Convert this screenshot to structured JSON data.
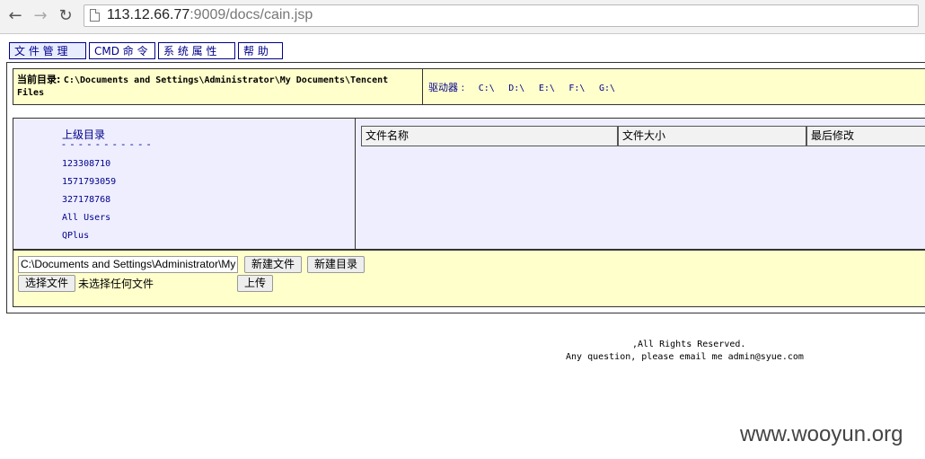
{
  "browser": {
    "url_host": "113.12.66.77",
    "url_rest": ":9009/docs/cain.jsp"
  },
  "menu": {
    "file_manage": "文 件 管 理",
    "cmd": "CMD 命 令",
    "sys_props": "系 统 属 性",
    "help": "帮 助"
  },
  "current_dir": {
    "label": "当前目录:",
    "path": "C:\\Documents and Settings\\Administrator\\My Documents\\Tencent Files"
  },
  "drives": {
    "label": "驱动器 :",
    "items": [
      "C:\\",
      "D:\\",
      "E:\\",
      "F:\\",
      "G:\\"
    ]
  },
  "left_pane": {
    "parent_link": "上级目录",
    "separator": "- - - - - - - - - - -",
    "dirs": [
      "123308710",
      "1571793059",
      "327178768",
      "All Users",
      "QPlus"
    ]
  },
  "file_table": {
    "headers": [
      "文件名称",
      "文件大小",
      "最后修改"
    ]
  },
  "bottom": {
    "path_value": "C:\\Documents and Settings\\Administrator\\My Documents\\Tencent Files",
    "new_file": "新建文件",
    "new_dir": "新建目录",
    "choose_file": "选择文件",
    "no_file": "未选择任何文件",
    "upload": "上传"
  },
  "footer": {
    "rights": ",All Rights Reserved.",
    "question": "Any question, please email me admin@syue.com"
  },
  "watermark": "www.wooyun.org"
}
